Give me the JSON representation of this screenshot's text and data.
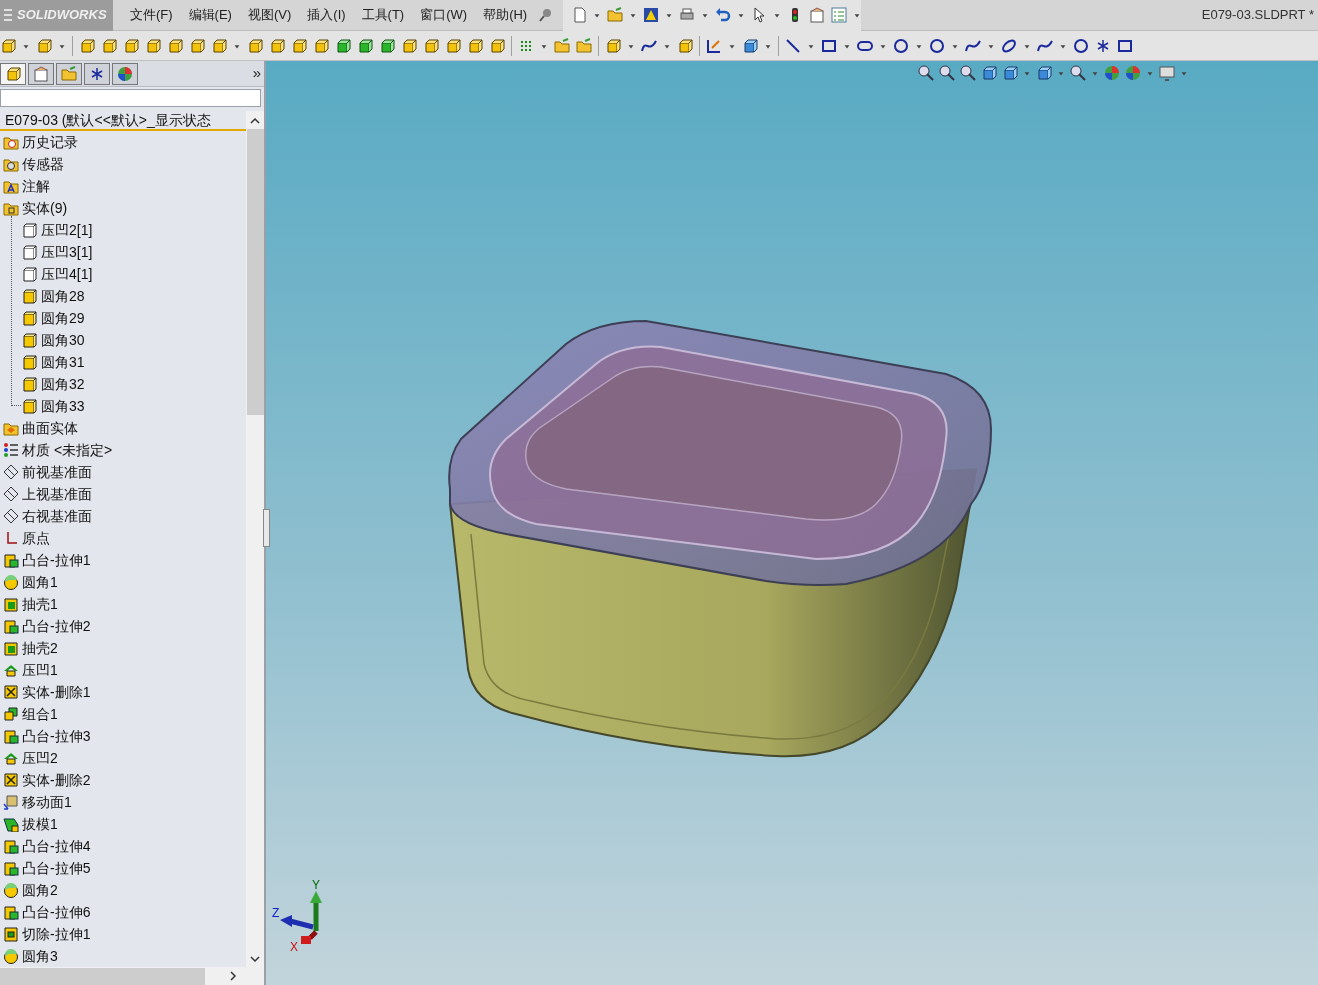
{
  "app": {
    "logo": "SOLIDWORKS",
    "document_title": "E079-03.SLDPRT *"
  },
  "menu": [
    "文件(F)",
    "编辑(E)",
    "视图(V)",
    "插入(I)",
    "工具(T)",
    "窗口(W)",
    "帮助(H)"
  ],
  "panel": {
    "more": "»",
    "root": "E079-03  (默认<<默认>_显示状态",
    "tree": [
      {
        "label": "历史记录",
        "kind": "history"
      },
      {
        "label": "传感器",
        "kind": "sensor"
      },
      {
        "label": "注解",
        "kind": "annotation"
      },
      {
        "label": "实体(9)",
        "kind": "folder",
        "expanded": true,
        "children": [
          {
            "label": "压凹2[1]",
            "kind": "body-outline"
          },
          {
            "label": "压凹3[1]",
            "kind": "body-outline"
          },
          {
            "label": "压凹4[1]",
            "kind": "body-outline"
          },
          {
            "label": "圆角28",
            "kind": "body"
          },
          {
            "label": "圆角29",
            "kind": "body"
          },
          {
            "label": "圆角30",
            "kind": "body"
          },
          {
            "label": "圆角31",
            "kind": "body"
          },
          {
            "label": "圆角32",
            "kind": "body"
          },
          {
            "label": "圆角33",
            "kind": "body"
          }
        ]
      },
      {
        "label": "曲面实体",
        "kind": "surface"
      },
      {
        "label": "材质 <未指定>",
        "kind": "material"
      },
      {
        "label": "前视基准面",
        "kind": "plane"
      },
      {
        "label": "上视基准面",
        "kind": "plane"
      },
      {
        "label": "右视基准面",
        "kind": "plane"
      },
      {
        "label": "原点",
        "kind": "origin"
      },
      {
        "label": "凸台-拉伸1",
        "kind": "extrude"
      },
      {
        "label": "圆角1",
        "kind": "fillet"
      },
      {
        "label": "抽壳1",
        "kind": "shell"
      },
      {
        "label": "凸台-拉伸2",
        "kind": "extrude"
      },
      {
        "label": "抽壳2",
        "kind": "shell"
      },
      {
        "label": "压凹1",
        "kind": "indent"
      },
      {
        "label": "实体-删除1",
        "kind": "delete"
      },
      {
        "label": "组合1",
        "kind": "combine"
      },
      {
        "label": "凸台-拉伸3",
        "kind": "extrude"
      },
      {
        "label": "压凹2",
        "kind": "indent"
      },
      {
        "label": "实体-删除2",
        "kind": "delete"
      },
      {
        "label": "移动面1",
        "kind": "move"
      },
      {
        "label": "拔模1",
        "kind": "draft"
      },
      {
        "label": "凸台-拉伸4",
        "kind": "extrude"
      },
      {
        "label": "凸台-拉伸5",
        "kind": "extrude"
      },
      {
        "label": "圆角2",
        "kind": "fillet"
      },
      {
        "label": "凸台-拉伸6",
        "kind": "extrude"
      },
      {
        "label": "切除-拉伸1",
        "kind": "cut"
      },
      {
        "label": "圆角3",
        "kind": "fillet"
      }
    ]
  },
  "triad": {
    "x": "X",
    "y": "Y",
    "z": "Z"
  }
}
